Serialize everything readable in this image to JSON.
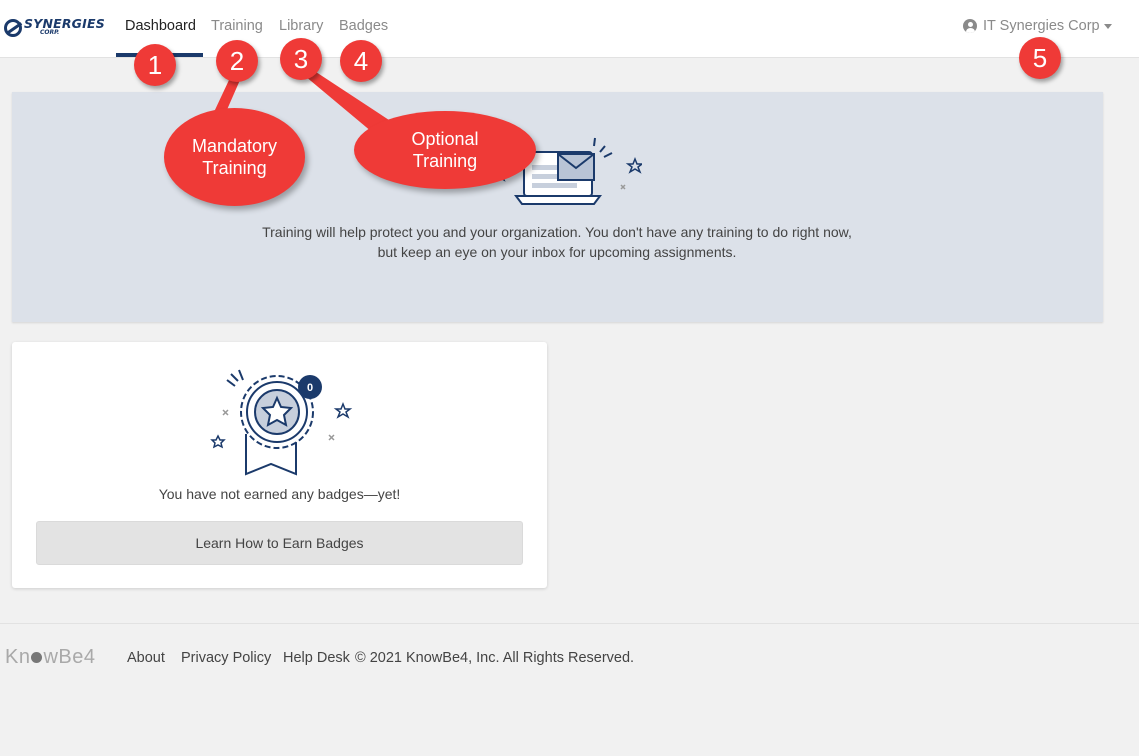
{
  "header": {
    "logo_text": "SYNERGIES",
    "logo_sub": "CORP.",
    "tabs": [
      {
        "label": "Dashboard",
        "active": true
      },
      {
        "label": "Training",
        "active": false
      },
      {
        "label": "Library",
        "active": false
      },
      {
        "label": "Badges",
        "active": false
      }
    ],
    "user_menu": {
      "label": "IT Synergies Corp",
      "icon": "user-circle-icon"
    }
  },
  "training_banner": {
    "illustration": "laptop-envelope-icon",
    "message": "Training will help protect you and your organization. You don't have any training to do right now, but keep an eye on your inbox for upcoming assignments."
  },
  "badges_card": {
    "illustration": "award-ribbon-icon",
    "count": "0",
    "message": "You have not earned any badges—yet!",
    "button_label": "Learn How to Earn Badges"
  },
  "footer": {
    "brand": {
      "before": "Kn",
      "after": "wBe4"
    },
    "links": [
      "About",
      "Privacy Policy",
      "Help Desk"
    ],
    "copyright": "© 2021 KnowBe4, Inc. All Rights Reserved."
  },
  "annotations": {
    "markers": [
      "1",
      "2",
      "3",
      "4",
      "5"
    ],
    "callouts": [
      {
        "line1": "Mandatory",
        "line2": "Training"
      },
      {
        "line1": "Optional",
        "line2": "Training"
      }
    ]
  },
  "colors": {
    "brand_navy": "#1b3a6b",
    "banner_bg": "#dce1e9",
    "annotation_red": "#ef3a37",
    "page_bg": "#f1f1f1"
  }
}
